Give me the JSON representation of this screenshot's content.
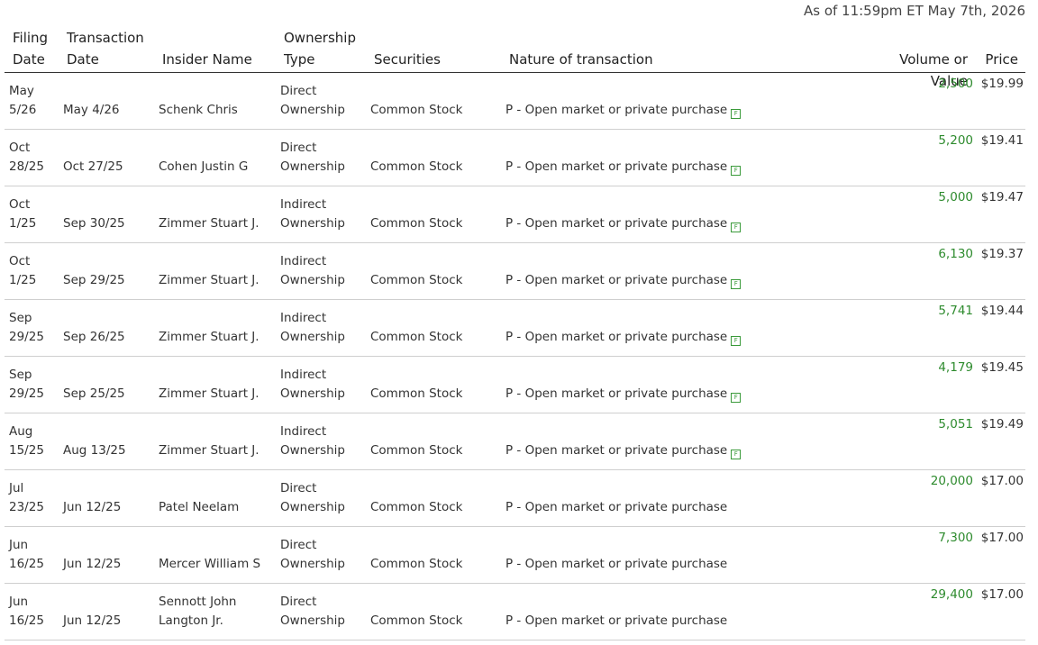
{
  "as_of": "As of 11:59pm ET May 7th, 2026",
  "headers": {
    "filing_date": [
      "Filing",
      "Date"
    ],
    "transaction_date": [
      "Transaction",
      "Date"
    ],
    "insider_name": "Insider Name",
    "ownership_type": [
      "Ownership",
      "Type"
    ],
    "securities": "Securities",
    "nature": "Nature of transaction",
    "volume": "Volume or Value",
    "price": "Price"
  },
  "footnote_icon": "form-f-icon",
  "colors": {
    "volume": "#2e8b2e",
    "icon": "#3a9a3a",
    "divider": "#cfcfcf"
  },
  "rows": [
    {
      "filing": [
        "May",
        "5/26"
      ],
      "trans": "May 4/26",
      "insider": [
        "",
        "Schenk Chris"
      ],
      "own": [
        "Direct",
        "Ownership"
      ],
      "sec": "Common Stock",
      "nature": "P - Open market or private purchase",
      "icon": true,
      "volume": "2,500",
      "price": "$19.99"
    },
    {
      "filing": [
        "Oct",
        "28/25"
      ],
      "trans": "Oct 27/25",
      "insider": [
        "",
        "Cohen Justin G"
      ],
      "own": [
        "Direct",
        "Ownership"
      ],
      "sec": "Common Stock",
      "nature": "P - Open market or private purchase",
      "icon": true,
      "volume": "5,200",
      "price": "$19.41"
    },
    {
      "filing": [
        "Oct",
        "1/25"
      ],
      "trans": "Sep 30/25",
      "insider": [
        "",
        "Zimmer Stuart J."
      ],
      "own": [
        "Indirect",
        "Ownership"
      ],
      "sec": "Common Stock",
      "nature": "P - Open market or private purchase",
      "icon": true,
      "volume": "5,000",
      "price": "$19.47"
    },
    {
      "filing": [
        "Oct",
        "1/25"
      ],
      "trans": "Sep 29/25",
      "insider": [
        "",
        "Zimmer Stuart J."
      ],
      "own": [
        "Indirect",
        "Ownership"
      ],
      "sec": "Common Stock",
      "nature": "P - Open market or private purchase",
      "icon": true,
      "volume": "6,130",
      "price": "$19.37"
    },
    {
      "filing": [
        "Sep",
        "29/25"
      ],
      "trans": "Sep 26/25",
      "insider": [
        "",
        "Zimmer Stuart J."
      ],
      "own": [
        "Indirect",
        "Ownership"
      ],
      "sec": "Common Stock",
      "nature": "P - Open market or private purchase",
      "icon": true,
      "volume": "5,741",
      "price": "$19.44"
    },
    {
      "filing": [
        "Sep",
        "29/25"
      ],
      "trans": "Sep 25/25",
      "insider": [
        "",
        "Zimmer Stuart J."
      ],
      "own": [
        "Indirect",
        "Ownership"
      ],
      "sec": "Common Stock",
      "nature": "P - Open market or private purchase",
      "icon": true,
      "volume": "4,179",
      "price": "$19.45"
    },
    {
      "filing": [
        "Aug",
        "15/25"
      ],
      "trans": "Aug 13/25",
      "insider": [
        "",
        "Zimmer Stuart J."
      ],
      "own": [
        "Indirect",
        "Ownership"
      ],
      "sec": "Common Stock",
      "nature": "P - Open market or private purchase",
      "icon": true,
      "volume": "5,051",
      "price": "$19.49"
    },
    {
      "filing": [
        "Jul",
        "23/25"
      ],
      "trans": "Jun 12/25",
      "insider": [
        "",
        "Patel Neelam"
      ],
      "own": [
        "Direct",
        "Ownership"
      ],
      "sec": "Common Stock",
      "nature": "P - Open market or private purchase",
      "icon": false,
      "volume": "20,000",
      "price": "$17.00"
    },
    {
      "filing": [
        "Jun",
        "16/25"
      ],
      "trans": "Jun 12/25",
      "insider": [
        "",
        "Mercer William S"
      ],
      "own": [
        "Direct",
        "Ownership"
      ],
      "sec": "Common Stock",
      "nature": "P - Open market or private purchase",
      "icon": false,
      "volume": "7,300",
      "price": "$17.00"
    },
    {
      "filing": [
        "Jun",
        "16/25"
      ],
      "trans": "Jun 12/25",
      "insider": [
        "Sennott John",
        "Langton Jr."
      ],
      "own": [
        "Direct",
        "Ownership"
      ],
      "sec": "Common Stock",
      "nature": "P - Open market or private purchase",
      "icon": false,
      "volume": "29,400",
      "price": "$17.00"
    }
  ]
}
